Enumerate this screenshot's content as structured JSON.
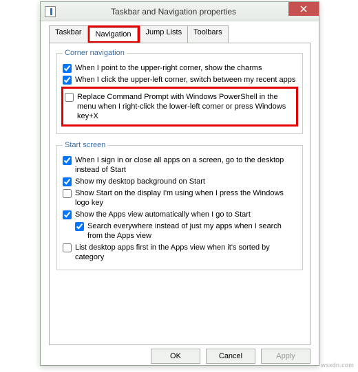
{
  "window": {
    "title": "Taskbar and Navigation properties"
  },
  "tabs": {
    "t0": "Taskbar",
    "t1": "Navigation",
    "t2": "Jump Lists",
    "t3": "Toolbars"
  },
  "groups": {
    "corner": {
      "legend": "Corner navigation",
      "opt1": "When I point to the upper-right corner, show the charms",
      "opt2": "When I click the upper-left corner, switch between my recent apps",
      "opt3": "Replace Command Prompt with Windows PowerShell in the menu when I right-click the lower-left corner or press Windows key+X"
    },
    "start": {
      "legend": "Start screen",
      "opt1": "When I sign in or close all apps on a screen, go to the desktop instead of Start",
      "opt2": "Show my desktop background on Start",
      "opt3": "Show Start on the display I'm using when I press the Windows logo key",
      "opt4": "Show the Apps view automatically when I go to Start",
      "opt5": "Search everywhere instead of just my apps when I search from the Apps view",
      "opt6": "List desktop apps first in the Apps view when it's sorted by category"
    }
  },
  "buttons": {
    "ok": "OK",
    "cancel": "Cancel",
    "apply": "Apply"
  },
  "watermark": "wsxdn.com"
}
